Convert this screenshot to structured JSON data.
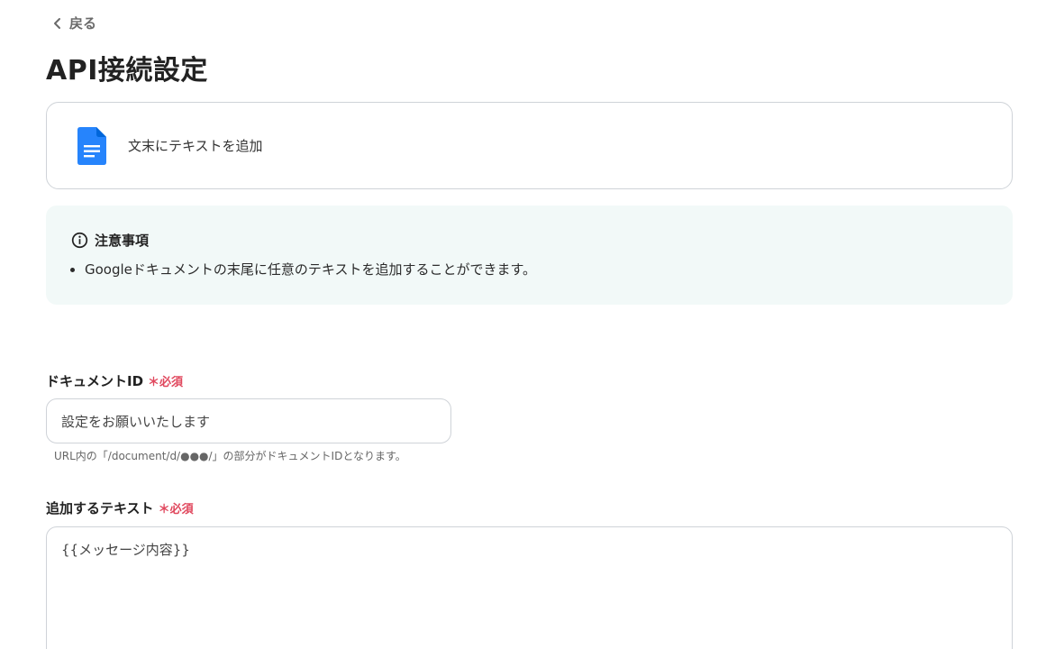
{
  "nav": {
    "back_label": "戻る"
  },
  "page": {
    "title": "API接続設定"
  },
  "action": {
    "label": "文末にテキストを追加",
    "icon": "google-docs-icon",
    "icon_color": "#2684fc"
  },
  "notice": {
    "title": "注意事項",
    "items": [
      "Googleドキュメントの末尾に任意のテキストを追加することができます。"
    ],
    "background": "#f2f9f8"
  },
  "fields": {
    "document_id": {
      "label": "ドキュメントID",
      "required_label": "＊必須",
      "value": "設定をお願いいたします",
      "helper": "URL内の「/document/d/●●●/」の部分がドキュメントIDとなります。"
    },
    "text": {
      "label": "追加するテキスト",
      "required_label": "＊必須",
      "value": "{{メッセージ内容}}"
    }
  },
  "colors": {
    "required": "#e0475d",
    "border": "#cfd3d8"
  }
}
